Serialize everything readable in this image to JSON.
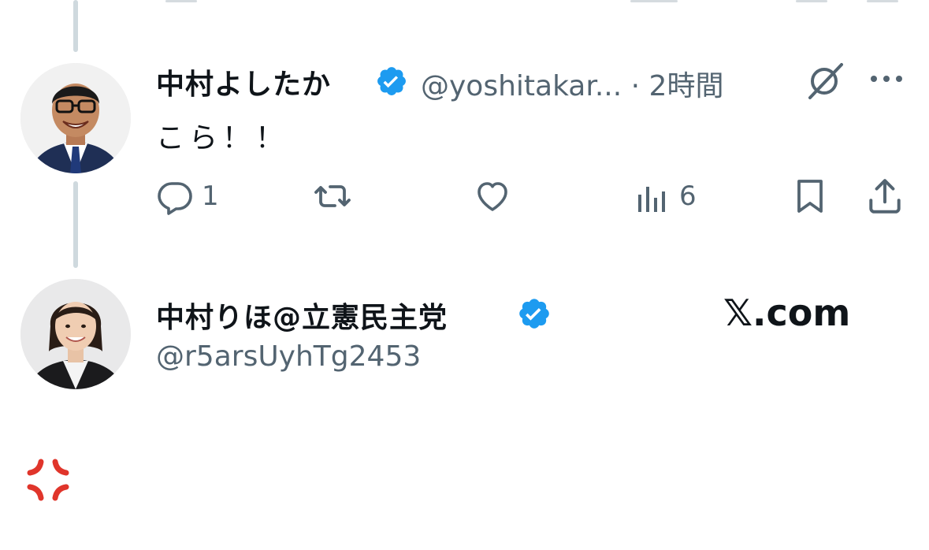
{
  "tweet": {
    "author_name": "中村よしたか",
    "handle": "@yoshitakar...",
    "separator": "·",
    "time": "2時間",
    "text": "こら！！",
    "actions": {
      "reply_count": "1",
      "views_count": "6"
    },
    "icons": {
      "verified": "verified-badge-icon",
      "grok": "grok-icon",
      "more": "more-icon",
      "reply": "reply-icon",
      "retweet": "retweet-icon",
      "like": "like-icon",
      "views": "views-icon",
      "bookmark": "bookmark-icon",
      "share": "share-icon"
    }
  },
  "reply_card": {
    "author_name": "中村りほ@立憲民主党",
    "handle": "@r5arsUyhTg2453",
    "brand": "𝕏.com",
    "icons": {
      "verified": "verified-badge-icon"
    }
  },
  "emoji": "💢",
  "colors": {
    "verified_blue": "#1d9bf0",
    "text": "#0f1419",
    "secondary": "#536471",
    "thread_line": "#cfd9de",
    "anger": "#e0352b"
  }
}
